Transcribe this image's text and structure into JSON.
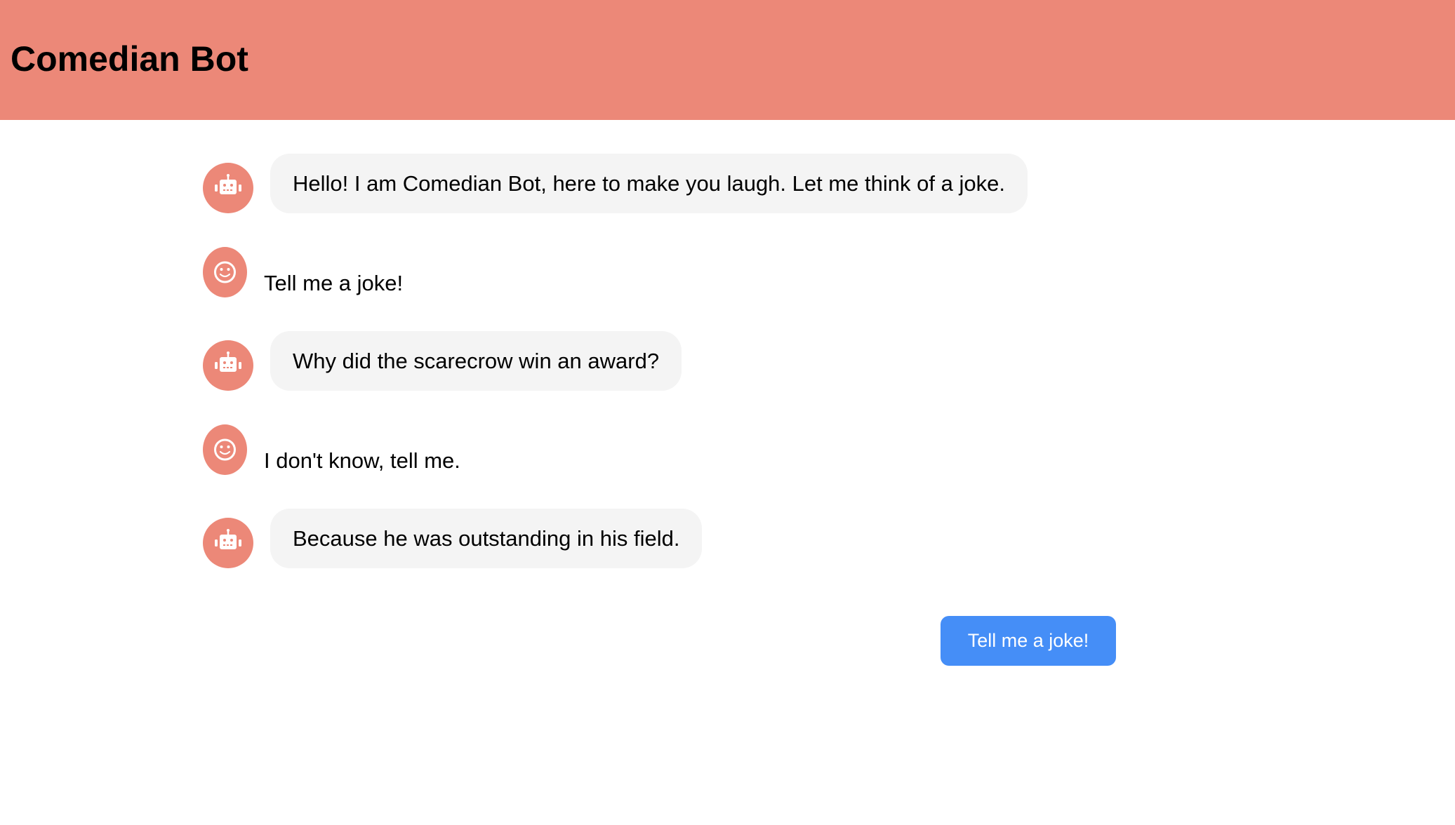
{
  "header": {
    "title": "Comedian Bot",
    "background_color": "#ec8878"
  },
  "messages": [
    {
      "sender": "bot",
      "icon": "robot-icon",
      "text": "Hello! I am Comedian Bot, here to make you laugh. Let me think of a joke."
    },
    {
      "sender": "user",
      "icon": "smiley-face-icon",
      "text": "Tell me a joke!"
    },
    {
      "sender": "bot",
      "icon": "robot-icon",
      "text": "Why did the scarecrow win an award?"
    },
    {
      "sender": "user",
      "icon": "smiley-face-icon",
      "text": "I don't know, tell me."
    },
    {
      "sender": "bot",
      "icon": "robot-icon",
      "text": "Because he was outstanding in his field."
    }
  ],
  "action": {
    "button_label": "Tell me a joke!",
    "button_color": "#458ef7"
  },
  "colors": {
    "avatar": "#ec8878",
    "bot_bubble": "#f4f4f4"
  }
}
